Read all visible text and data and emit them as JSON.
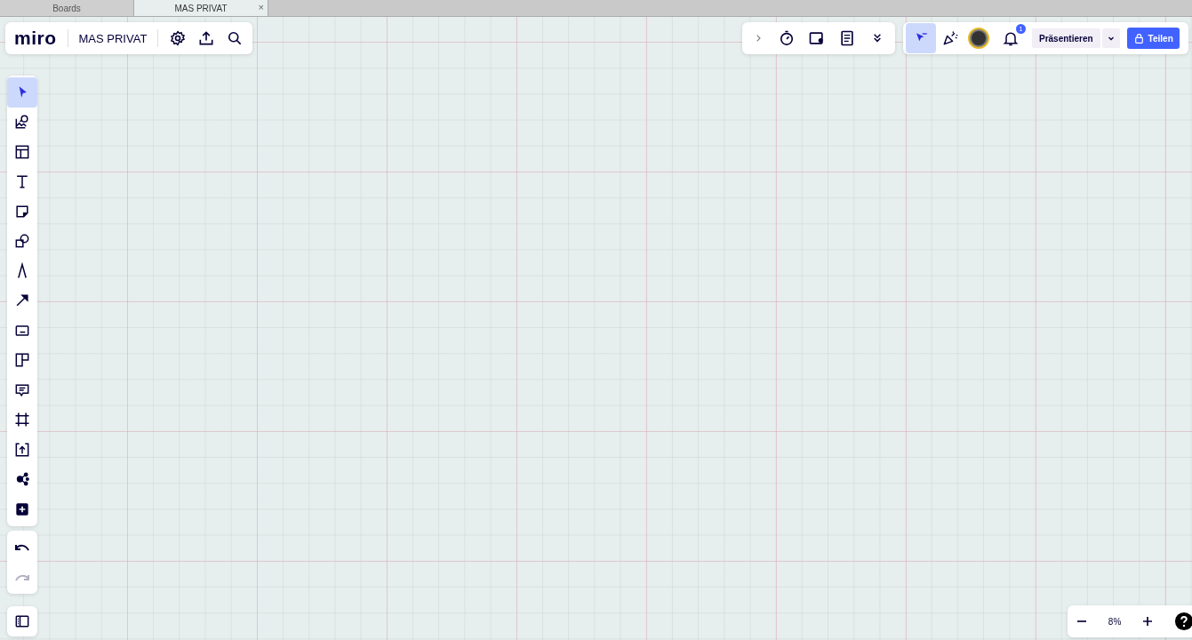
{
  "browser_tabs": [
    {
      "label": "Boards",
      "selected": false
    },
    {
      "label": "MAS PRIVAT",
      "selected": true,
      "close": "×"
    }
  ],
  "header": {
    "logo": "miro",
    "board_name": "MAS PRIVAT"
  },
  "tools": [
    {
      "kind": "select",
      "selected": true
    },
    {
      "kind": "image",
      "selected": false
    },
    {
      "kind": "layout",
      "selected": false
    },
    {
      "kind": "text",
      "selected": false
    },
    {
      "kind": "sticky",
      "selected": false
    },
    {
      "kind": "shapes",
      "selected": false
    },
    {
      "kind": "pen",
      "selected": false
    },
    {
      "kind": "arrow",
      "selected": false
    },
    {
      "kind": "card",
      "selected": false
    },
    {
      "kind": "kanban",
      "selected": false
    },
    {
      "kind": "comment",
      "selected": false
    },
    {
      "kind": "frame",
      "selected": false
    },
    {
      "kind": "upload",
      "selected": false
    },
    {
      "kind": "mindmap",
      "selected": false
    },
    {
      "kind": "add",
      "selected": false
    }
  ],
  "history": [
    {
      "kind": "undo",
      "disabled": false
    },
    {
      "kind": "redo",
      "disabled": true
    }
  ],
  "top_right": {
    "cursor_mode_selected": true,
    "notifications": "1",
    "present_button": "Präsentieren",
    "share_button": "Teilen"
  },
  "zoom": {
    "value": "8%"
  }
}
